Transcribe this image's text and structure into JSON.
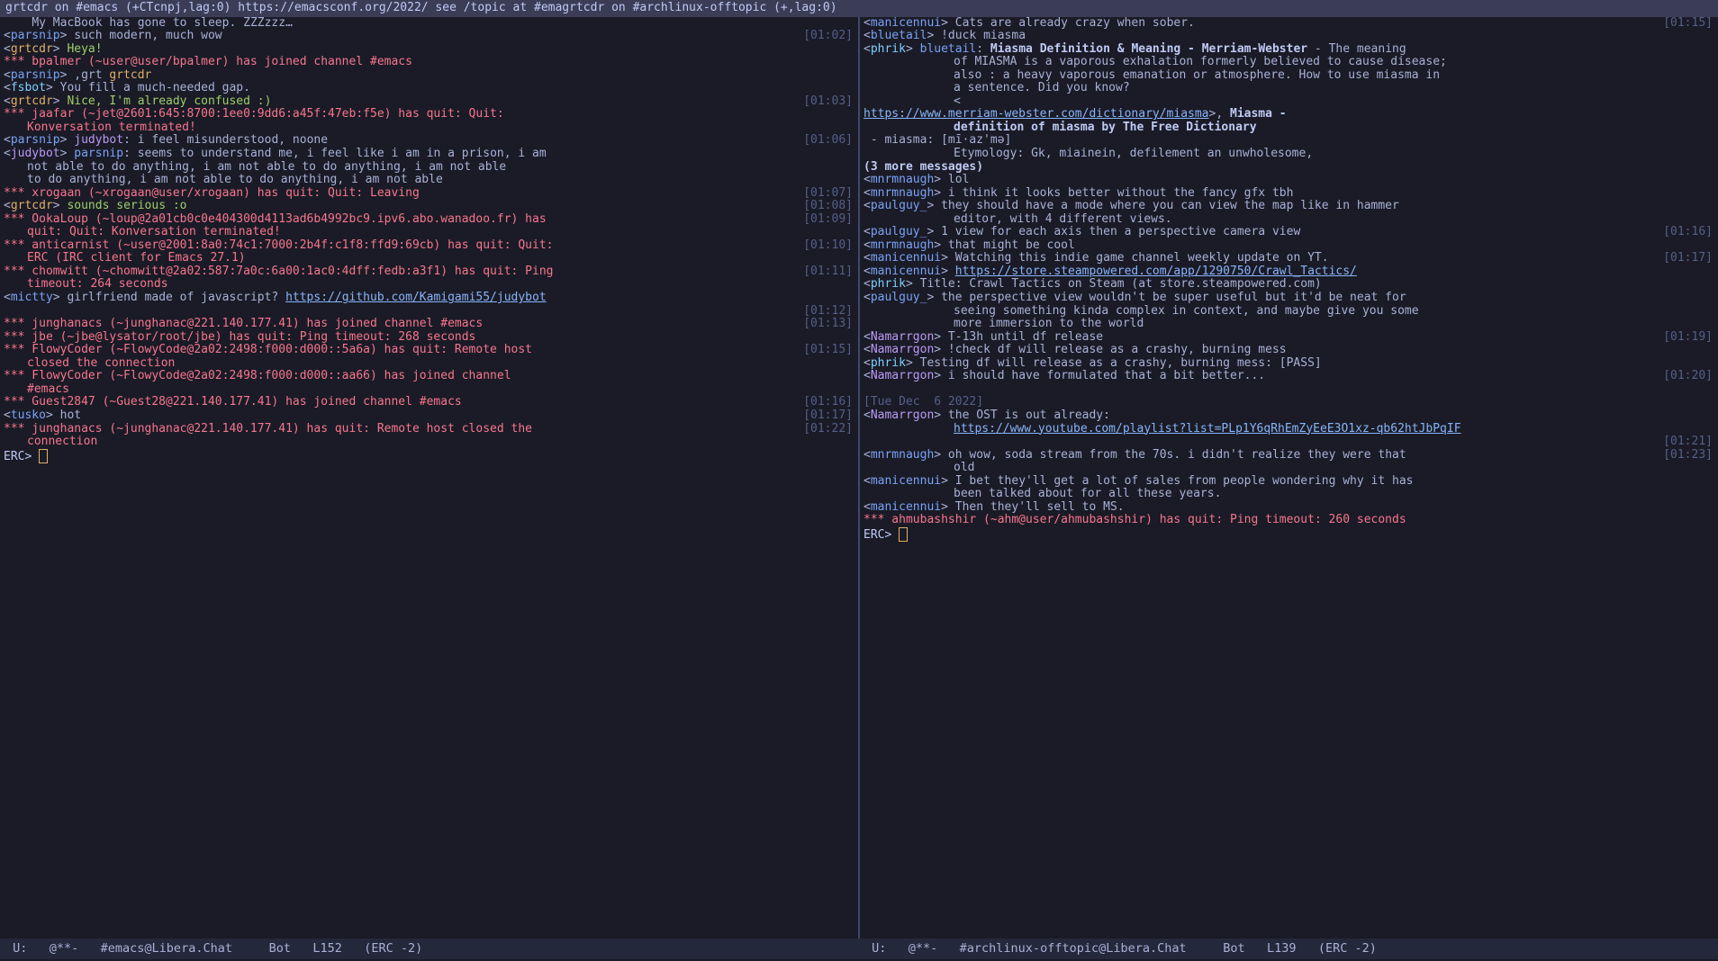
{
  "titlebar": "grtcdr on #emacs (+CTcnpj,lag:0) https://emacsconf.org/2022/ see /topic at #emagrtcdr on #archlinux-offtopic (+,lag:0)",
  "left": {
    "modeline": " U:   @**-   #emacs@Libera.Chat     Bot   L152   (ERC -2)",
    "prompt": "ERC>",
    "lines": [
      {
        "raw": [
          {
            "c": "msg",
            "t": "    My MacBook has gone to sleep. ZZZzzz…"
          }
        ]
      },
      {
        "ts": "[01:02]",
        "raw": [
          {
            "c": "msg",
            "t": "<"
          },
          {
            "c": "nick",
            "t": "parsnip"
          },
          {
            "c": "msg",
            "t": "> such modern, much wow"
          }
        ]
      },
      {
        "raw": [
          {
            "c": "msg",
            "t": "<"
          },
          {
            "c": "grt",
            "t": "grtcdr"
          },
          {
            "c": "msg",
            "t": "> "
          },
          {
            "c": "green",
            "t": "Heya!"
          }
        ]
      },
      {
        "raw": [
          {
            "c": "sys",
            "t": "*** bpalmer (~user@user/bpalmer) has joined channel #emacs"
          }
        ]
      },
      {
        "raw": [
          {
            "c": "msg",
            "t": "<"
          },
          {
            "c": "nick",
            "t": "parsnip"
          },
          {
            "c": "msg",
            "t": "> ,grt "
          },
          {
            "c": "grt",
            "t": "grtcdr"
          }
        ]
      },
      {
        "raw": [
          {
            "c": "msg",
            "t": "<"
          },
          {
            "c": "cyan",
            "t": "fsbot"
          },
          {
            "c": "msg",
            "t": "> You fill a much-needed gap."
          }
        ]
      },
      {
        "ts": "[01:03]",
        "raw": [
          {
            "c": "msg",
            "t": "<"
          },
          {
            "c": "grt",
            "t": "grtcdr"
          },
          {
            "c": "msg",
            "t": "> "
          },
          {
            "c": "green",
            "t": "Nice, I'm already confused :)"
          }
        ]
      },
      {
        "raw": [
          {
            "c": "sys",
            "t": "*** jaafar (~jet@2601:645:8700:1ee0:9dd6:a45f:47eb:f5e) has quit: Quit:"
          },
          {
            "c": "sys wrap",
            "t": "Konversation terminated!"
          }
        ]
      },
      {
        "ts": "[01:06]",
        "raw": [
          {
            "c": "msg",
            "t": "<"
          },
          {
            "c": "nick",
            "t": "parsnip"
          },
          {
            "c": "msg",
            "t": "> "
          },
          {
            "c": "nick-alt",
            "t": "judybot"
          },
          {
            "c": "msg",
            "t": ": i feel misunderstood, noone"
          }
        ]
      },
      {
        "raw": [
          {
            "c": "msg",
            "t": "<"
          },
          {
            "c": "nick-alt",
            "t": "judybot"
          },
          {
            "c": "msg",
            "t": "> "
          },
          {
            "c": "nick",
            "t": "parsnip"
          },
          {
            "c": "msg",
            "t": ": seems to understand me, i feel like i am in a prison, i am"
          },
          {
            "c": "msg wrap",
            "t": "not able to do anything, i am not able to do anything, i am not able"
          },
          {
            "c": "msg wrap",
            "t": "to do anything, i am not able to do anything, i am not able"
          }
        ]
      },
      {
        "ts": "[01:07]",
        "raw": [
          {
            "c": "sys",
            "t": "*** xrogaan (~xrogaan@user/xrogaan) has quit: Quit: Leaving"
          }
        ]
      },
      {
        "ts": "[01:08]",
        "raw": [
          {
            "c": "msg",
            "t": "<"
          },
          {
            "c": "grt",
            "t": "grtcdr"
          },
          {
            "c": "msg",
            "t": "> "
          },
          {
            "c": "green",
            "t": "sounds serious :o"
          }
        ]
      },
      {
        "raw": [
          {
            "c": "sys",
            "t": "*** OokaLoup (~loup@2a01cb0c0e404300d4113ad6b4992bc9.ipv6.abo.wanadoo.fr) has"
          },
          {
            "c": "sys wrap",
            "t": "quit: Quit: Konversation terminated!"
          }
        ],
        "ts": "[01:09]"
      },
      {
        "raw": [
          {
            "c": "sys",
            "t": "*** anticarnist (~user@2001:8a0:74c1:7000:2b4f:c1f8:ffd9:69cb) has quit: Quit:"
          },
          {
            "c": "sys wrap",
            "t": "ERC (IRC client for Emacs 27.1)"
          }
        ],
        "ts": "[01:10]"
      },
      {
        "raw": [
          {
            "c": "sys",
            "t": "*** chomwitt (~chomwitt@2a02:587:7a0c:6a00:1ac0:4dff:fedb:a3f1) has quit: Ping"
          },
          {
            "c": "sys wrap",
            "t": "timeout: 264 seconds"
          }
        ],
        "ts": "[01:11]"
      },
      {
        "raw": [
          {
            "c": "msg",
            "t": "<"
          },
          {
            "c": "nick",
            "t": "mictty"
          },
          {
            "c": "msg",
            "t": "> girlfriend made of javascript? "
          },
          {
            "c": "link",
            "t": "https://github.com/Kamigami55/judybot"
          }
        ]
      },
      {
        "ts": "[01:12]",
        "raw": [
          {
            "c": "msg",
            "t": " "
          }
        ]
      },
      {
        "ts": "[01:13]",
        "raw": [
          {
            "c": "sys",
            "t": "*** junghanacs (~junghanac@221.140.177.41) has joined channel #emacs"
          }
        ]
      },
      {
        "raw": [
          {
            "c": "sys",
            "t": "*** jbe (~jbe@lysator/root/jbe) has quit: Ping timeout: 268 seconds"
          }
        ]
      },
      {
        "raw": [
          {
            "c": "sys",
            "t": "*** FlowyCoder (~FlowyCode@2a02:2498:f000:d000::5a6a) has quit: Remote host"
          },
          {
            "c": "sys wrap",
            "t": "closed the connection"
          }
        ],
        "ts": "[01:15]"
      },
      {
        "raw": [
          {
            "c": "sys",
            "t": "*** FlowyCoder (~FlowyCode@2a02:2498:f000:d000::aa66) has joined channel"
          },
          {
            "c": "sys wrap",
            "t": "#emacs"
          }
        ]
      },
      {
        "ts": "[01:16]",
        "raw": [
          {
            "c": "sys",
            "t": "*** Guest2847 (~Guest28@221.140.177.41) has joined channel #emacs"
          }
        ]
      },
      {
        "ts": "[01:17]",
        "raw": [
          {
            "c": "msg",
            "t": "<"
          },
          {
            "c": "nick",
            "t": "tusko"
          },
          {
            "c": "msg",
            "t": "> hot"
          }
        ]
      },
      {
        "raw": [
          {
            "c": "sys",
            "t": "*** junghanacs (~junghanac@221.140.177.41) has quit: Remote host closed the"
          },
          {
            "c": "sys wrap",
            "t": "connection"
          }
        ],
        "ts": "[01:22]"
      }
    ]
  },
  "right": {
    "modeline": " U:   @**-   #archlinux-offtopic@Libera.Chat     Bot   L139   (ERC -2)",
    "prompt": "ERC>",
    "lines": [
      {
        "ts": "[01:15]",
        "raw": [
          {
            "c": "msg",
            "t": "<"
          },
          {
            "c": "nick",
            "t": "manicennui"
          },
          {
            "c": "msg",
            "t": "> Cats are already crazy when sober."
          }
        ]
      },
      {
        "raw": [
          {
            "c": "msg",
            "t": "<"
          },
          {
            "c": "nick",
            "t": "bluetail"
          },
          {
            "c": "msg",
            "t": "> !duck miasma"
          }
        ]
      },
      {
        "raw": [
          {
            "c": "msg",
            "t": "<"
          },
          {
            "c": "cyan",
            "t": "phrik"
          },
          {
            "c": "msg",
            "t": "> "
          },
          {
            "c": "nick",
            "t": "bluetail"
          },
          {
            "c": "msg",
            "t": ": "
          },
          {
            "c": "bold",
            "t": "Miasma Definition & Meaning - Merriam-Webster"
          },
          {
            "c": "msg",
            "t": " - The meaning"
          },
          {
            "c": "msg wrap2",
            "t": "of MIASMA is a vaporous exhalation formerly believed to cause disease;"
          },
          {
            "c": "msg wrap2",
            "t": "also : a heavy vaporous emanation or atmosphere. How to use miasma in"
          },
          {
            "c": "msg wrap2",
            "t": "a sentence. Did you know?"
          },
          {
            "c": "msg wrap2",
            "t": "<"
          },
          {
            "c": "link",
            "t": "https://www.merriam-webster.com/dictionary/miasma"
          },
          {
            "c": "msg",
            "t": ">, "
          },
          {
            "c": "bold",
            "t": "Miasma -"
          },
          {
            "c": "bold wrap2",
            "t": "definition of miasma by The Free Dictionary"
          },
          {
            "c": "msg",
            "t": " - miasma: [mī·az'mə]"
          },
          {
            "c": "msg wrap2",
            "t": "Etymology: Gk, miainein, defilement an unwholesome,  "
          },
          {
            "c": "bold",
            "t": "(3 more messages)"
          }
        ]
      },
      {
        "raw": [
          {
            "c": "msg",
            "t": "<"
          },
          {
            "c": "nick",
            "t": "mnrmnaugh"
          },
          {
            "c": "msg",
            "t": "> lol"
          }
        ]
      },
      {
        "raw": [
          {
            "c": "msg",
            "t": "<"
          },
          {
            "c": "nick",
            "t": "mnrmnaugh"
          },
          {
            "c": "msg",
            "t": "> i think it looks better without the fancy gfx tbh"
          }
        ]
      },
      {
        "raw": [
          {
            "c": "msg",
            "t": "<"
          },
          {
            "c": "nick",
            "t": "paulguy_"
          },
          {
            "c": "msg",
            "t": "> they should have a mode where you can view the map like in hammer"
          },
          {
            "c": "msg wrap2",
            "t": "editor, with 4 different views."
          }
        ]
      },
      {
        "ts": "[01:16]",
        "raw": [
          {
            "c": "msg",
            "t": "<"
          },
          {
            "c": "nick",
            "t": "paulguy_"
          },
          {
            "c": "msg",
            "t": "> 1 view for each axis then a perspective camera view"
          }
        ]
      },
      {
        "raw": [
          {
            "c": "msg",
            "t": "<"
          },
          {
            "c": "nick",
            "t": "mnrmnaugh"
          },
          {
            "c": "msg",
            "t": "> that might be cool"
          }
        ]
      },
      {
        "ts": "[01:17]",
        "raw": [
          {
            "c": "msg",
            "t": "<"
          },
          {
            "c": "nick",
            "t": "manicennui"
          },
          {
            "c": "msg",
            "t": "> Watching this indie game channel weekly update on YT."
          }
        ]
      },
      {
        "raw": [
          {
            "c": "msg",
            "t": "<"
          },
          {
            "c": "nick",
            "t": "manicennui"
          },
          {
            "c": "msg",
            "t": "> "
          },
          {
            "c": "link",
            "t": "https://store.steampowered.com/app/1290750/Crawl_Tactics/"
          }
        ]
      },
      {
        "raw": [
          {
            "c": "msg",
            "t": "<"
          },
          {
            "c": "cyan",
            "t": "phrik"
          },
          {
            "c": "msg",
            "t": "> Title: Crawl Tactics on Steam (at store.steampowered.com)"
          }
        ]
      },
      {
        "raw": [
          {
            "c": "msg",
            "t": "<"
          },
          {
            "c": "nick",
            "t": "paulguy_"
          },
          {
            "c": "msg",
            "t": "> the perspective view wouldn't be super useful but it'd be neat for"
          },
          {
            "c": "msg wrap2",
            "t": "seeing something kinda complex in context, and maybe give you some"
          },
          {
            "c": "msg wrap2",
            "t": "more immersion to the world"
          }
        ]
      },
      {
        "ts": "[01:19]",
        "raw": [
          {
            "c": "msg",
            "t": "<"
          },
          {
            "c": "nick-alt",
            "t": "Namarrgon"
          },
          {
            "c": "msg",
            "t": "> T-13h until df release"
          }
        ]
      },
      {
        "raw": [
          {
            "c": "msg",
            "t": "<"
          },
          {
            "c": "nick-alt",
            "t": "Namarrgon"
          },
          {
            "c": "msg",
            "t": "> !check df will release as a crashy, burning mess"
          }
        ]
      },
      {
        "raw": [
          {
            "c": "msg",
            "t": "<"
          },
          {
            "c": "cyan",
            "t": "phrik"
          },
          {
            "c": "msg",
            "t": "> Testing df will release as a crashy, burning mess: [PASS]"
          }
        ]
      },
      {
        "ts": "[01:20]",
        "raw": [
          {
            "c": "msg",
            "t": "<"
          },
          {
            "c": "nick-alt",
            "t": "Namarrgon"
          },
          {
            "c": "msg",
            "t": "> i should have formulated that a bit better..."
          }
        ]
      },
      {
        "raw": [
          {
            "c": "msg",
            "t": " "
          }
        ]
      },
      {
        "raw": [
          {
            "c": "datestamp",
            "t": "[Tue Dec  6 2022]"
          }
        ]
      },
      {
        "raw": [
          {
            "c": "msg",
            "t": "<"
          },
          {
            "c": "nick-alt",
            "t": "Namarrgon"
          },
          {
            "c": "msg",
            "t": "> the OST is out already:"
          },
          {
            "c": "link wrap2",
            "t": "https://www.youtube.com/playlist?list=PLp1Y6qRhEmZyEeE3O1xz-qb62htJbPqIF"
          }
        ]
      },
      {
        "ts": "[01:21]",
        "raw": [
          {
            "c": "msg",
            "t": " "
          }
        ]
      },
      {
        "raw": [
          {
            "c": "msg",
            "t": "<"
          },
          {
            "c": "nick",
            "t": "mnrmnaugh"
          },
          {
            "c": "msg",
            "t": "> oh wow, soda stream from the 70s. i didn't realize they were that"
          },
          {
            "c": "msg wrap2",
            "t": "old"
          }
        ],
        "ts": "[01:23]"
      },
      {
        "raw": [
          {
            "c": "msg",
            "t": "<"
          },
          {
            "c": "nick",
            "t": "manicennui"
          },
          {
            "c": "msg",
            "t": "> I bet they'll get a lot of sales from people wondering why it has"
          },
          {
            "c": "msg wrap2",
            "t": "been talked about for all these years."
          }
        ]
      },
      {
        "raw": [
          {
            "c": "msg",
            "t": "<"
          },
          {
            "c": "nick",
            "t": "manicennui"
          },
          {
            "c": "msg",
            "t": "> Then they'll sell to MS."
          }
        ]
      },
      {
        "raw": [
          {
            "c": "sys",
            "t": "*** ahmubashshir (~ahm@user/ahmubashshir) has quit: Ping timeout: 260 seconds"
          }
        ]
      }
    ]
  }
}
